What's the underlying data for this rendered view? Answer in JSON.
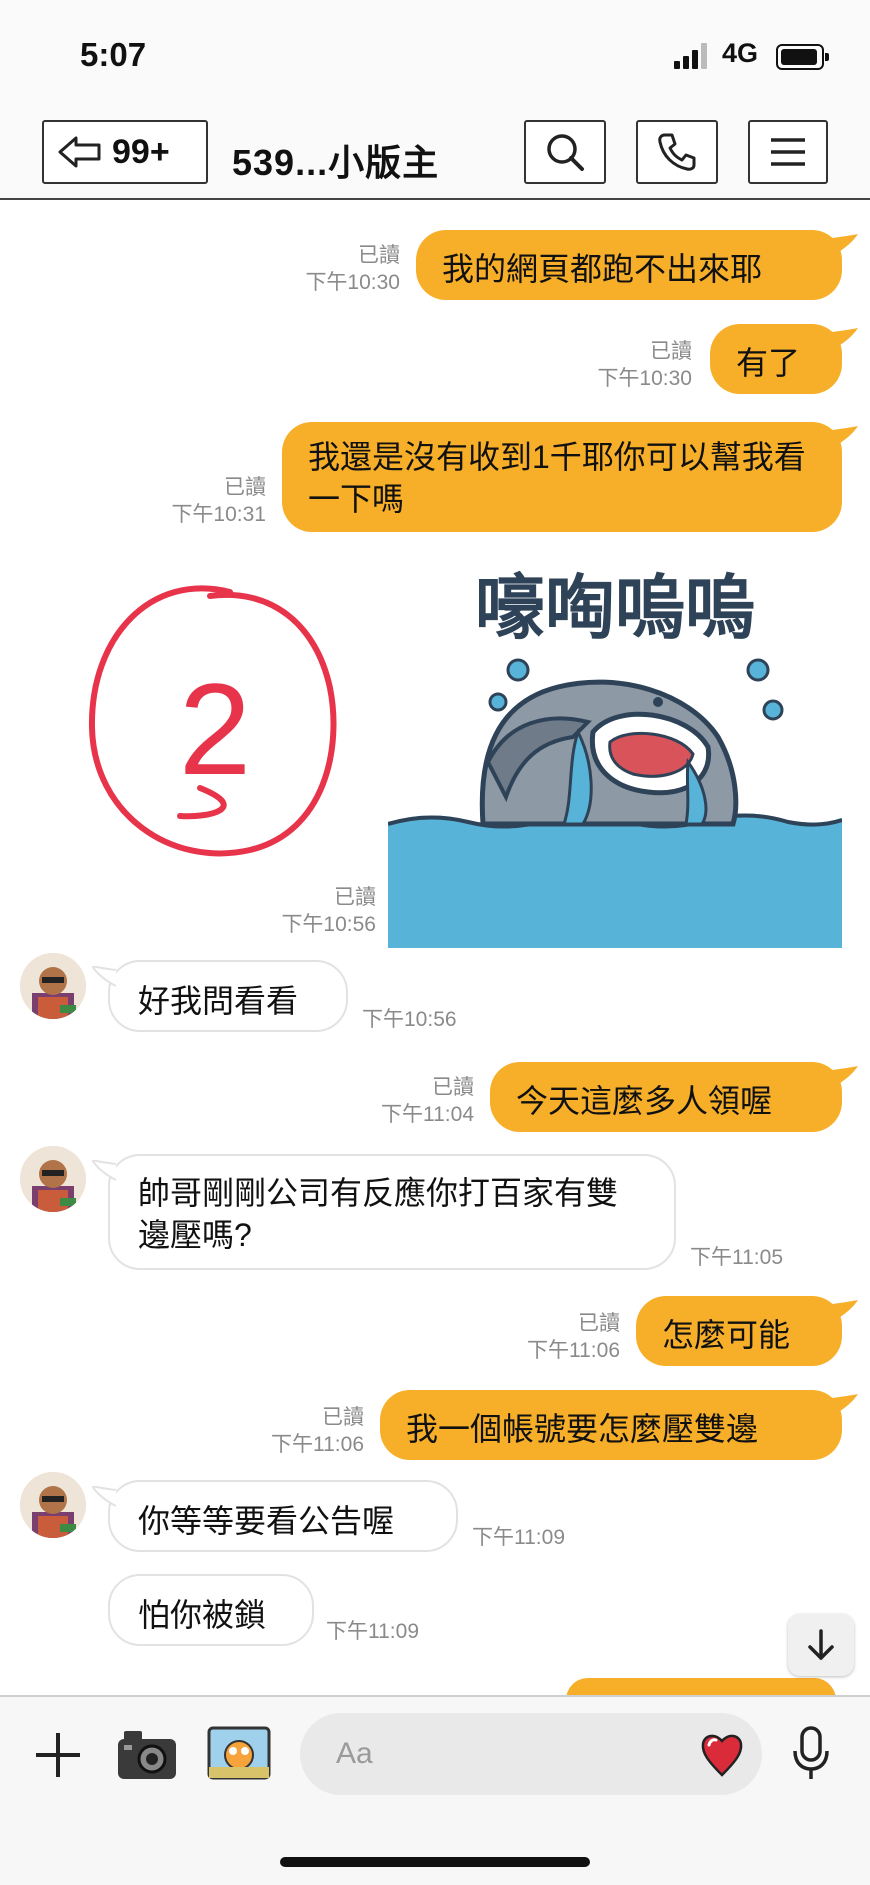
{
  "status": {
    "time": "5:07",
    "network": "4G"
  },
  "header": {
    "unread": "99+",
    "title": "539...小版主"
  },
  "messages": [
    {
      "side": "me",
      "text": "我的網頁都跑不出來耶",
      "read": "已讀",
      "time": "下午10:30"
    },
    {
      "side": "me",
      "text": "有了",
      "read": "已讀",
      "time": "下午10:30"
    },
    {
      "side": "me",
      "text": "我還是沒有收到1千耶你可以幫我看一下嗎",
      "read": "已讀",
      "time": "下午10:31"
    },
    {
      "side": "me",
      "type": "sticker",
      "text": "嚎啕嗚嗚",
      "read": "已讀",
      "time": "下午10:56",
      "annotation": "2"
    },
    {
      "side": "them",
      "text": "好我問看看",
      "time": "下午10:56"
    },
    {
      "side": "me",
      "text": "今天這麼多人領喔",
      "read": "已讀",
      "time": "下午11:04"
    },
    {
      "side": "them",
      "text": "帥哥剛剛公司有反應你打百家有雙邊壓嗎?",
      "time": "下午11:05"
    },
    {
      "side": "me",
      "text": "怎麼可能",
      "read": "已讀",
      "time": "下午11:06"
    },
    {
      "side": "me",
      "text": "我一個帳號要怎麼壓雙邊",
      "read": "已讀",
      "time": "下午11:06"
    },
    {
      "side": "them",
      "text": "你等等要看公告喔",
      "time": "下午11:09"
    },
    {
      "side": "them",
      "text": "怕你被鎖",
      "time": "下午11:09"
    }
  ],
  "input": {
    "placeholder": "Aa"
  },
  "colors": {
    "my_bubble": "#f7af2a",
    "their_bubble_border": "#e2e2e2",
    "annotation": "#e8344a",
    "heart": "#d92b3a"
  },
  "icons": [
    "back-arrow-icon",
    "search-icon",
    "phone-icon",
    "menu-icon",
    "plus-icon",
    "camera-icon",
    "photo-icon",
    "heart-icon",
    "microphone-icon",
    "arrow-down-icon"
  ]
}
